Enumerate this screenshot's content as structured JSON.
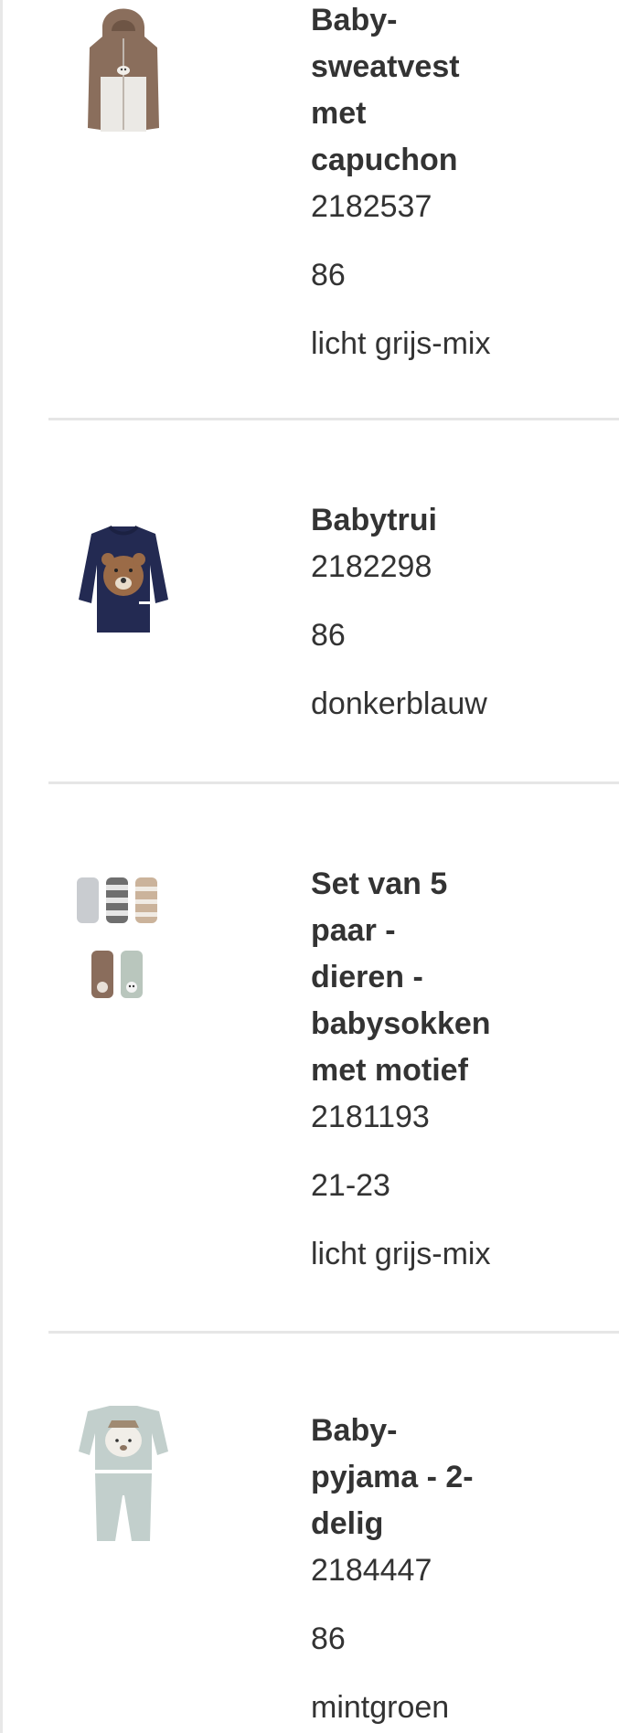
{
  "items": [
    {
      "title": "Baby-\nsweatvest\nmet\ncapuchon",
      "article_number": "2182537",
      "size": "86",
      "color": "licht grijs-mix",
      "icon": "hooded-sweat-jacket-icon"
    },
    {
      "title": "Babytrui",
      "article_number": "2182298",
      "size": "86",
      "color": "donkerblauw",
      "icon": "sweater-icon"
    },
    {
      "title": "Set van 5\npaar -\ndieren -\nbabysokken\nmet motief",
      "article_number": "2181193",
      "size": "21-23",
      "color": "licht grijs-mix",
      "icon": "socks-set-icon"
    },
    {
      "title": "Baby-\npyjama - 2-\ndelig",
      "article_number": "2184447",
      "size": "86",
      "color": "mintgroen",
      "icon": "pyjama-icon"
    }
  ],
  "colors": {
    "text": "#333333",
    "divider": "#e6e6e6",
    "background": "#ffffff"
  }
}
